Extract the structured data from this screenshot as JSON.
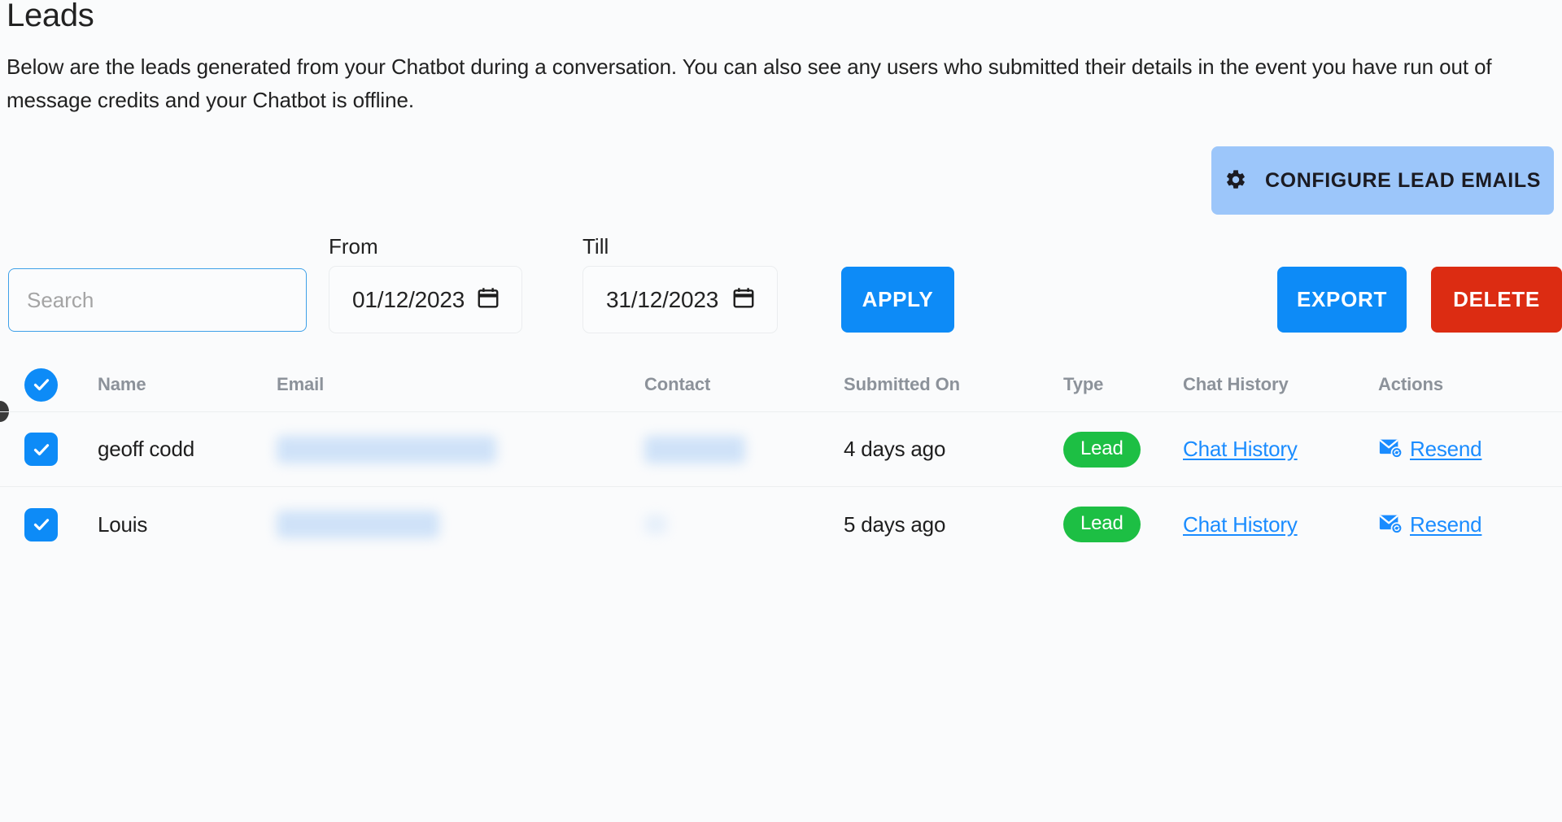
{
  "header": {
    "title": "Leads",
    "description": "Below are the leads generated from your Chatbot during a conversation. You can also see any users who submitted their details in the event you have run out of message credits and your Chatbot is offline."
  },
  "actions": {
    "configure_lead_emails": "CONFIGURE LEAD EMAILS",
    "configure_icon": "gear-icon",
    "apply": "APPLY",
    "export": "EXPORT",
    "delete": "DELETE"
  },
  "filters": {
    "search": {
      "value": "",
      "placeholder": "Search"
    },
    "from": {
      "label": "From",
      "value": "01/12/2023",
      "icon": "calendar-icon"
    },
    "till": {
      "label": "Till",
      "value": "31/12/2023",
      "icon": "calendar-icon"
    }
  },
  "table": {
    "select_all_checked": true,
    "columns": [
      "Name",
      "Email",
      "Contact",
      "Submitted On",
      "Type",
      "Chat History",
      "Actions"
    ],
    "rows": [
      {
        "checked": true,
        "name": "geoff codd",
        "email": "",
        "email_redacted": true,
        "contact": "",
        "contact_redacted": true,
        "submitted_on": "4 days ago",
        "type": "Lead",
        "chat_history_label": "Chat History",
        "action_label": "Resend",
        "action_icon": "email-resend-icon"
      },
      {
        "checked": true,
        "name": "Louis",
        "email": "",
        "email_redacted": true,
        "contact": "",
        "contact_redacted": true,
        "submitted_on": "5 days ago",
        "type": "Lead",
        "chat_history_label": "Chat History",
        "action_label": "Resend",
        "action_icon": "email-resend-icon"
      }
    ]
  },
  "colors": {
    "primary_blue": "#0d8bf7",
    "light_blue": "#9cc6fa",
    "danger_red": "#dc2c12",
    "badge_green": "#1dbf44",
    "link_blue": "#1a8cff",
    "page_bg": "#fafbfc"
  }
}
